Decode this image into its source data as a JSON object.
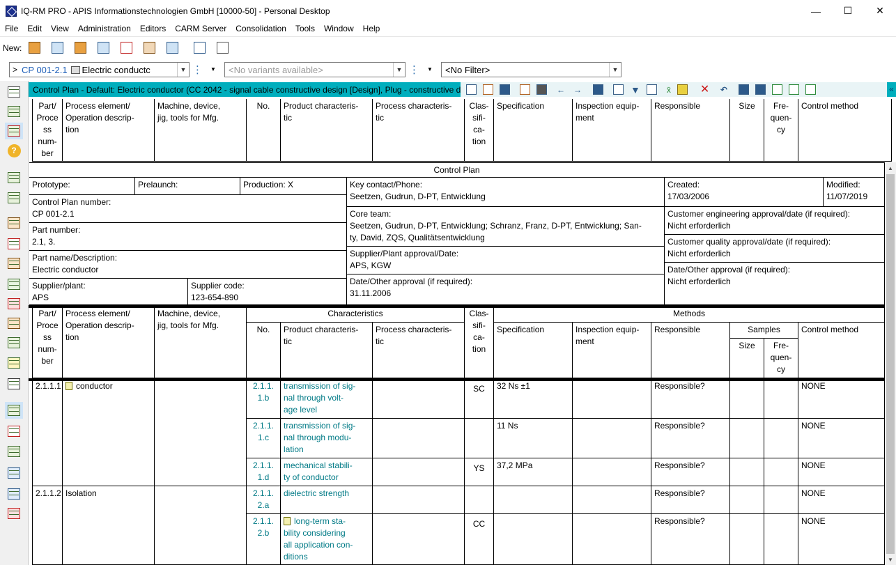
{
  "window": {
    "title": "IQ-RM PRO - APIS Informationstechnologien GmbH [10000-50] - Personal Desktop",
    "minimize": "—",
    "maximize": "☐",
    "close": "✕"
  },
  "menu": [
    "File",
    "Edit",
    "View",
    "Administration",
    "Editors",
    "CARM Server",
    "Consolidation",
    "Tools",
    "Window",
    "Help"
  ],
  "toolbar": {
    "new_label": "New:"
  },
  "selectors": {
    "doc_prefix": ">",
    "doc_id": "CP 001-2.1",
    "doc_name": "Electric conductc",
    "variants": "<No variants available>",
    "filter": "<No Filter>"
  },
  "panel": {
    "title": "Control Plan - Default: Electric conductor (CC 2042 - signal cable constructive design [Design], Plug - constructive d",
    "collapse": "«"
  },
  "columns": {
    "part": "Part/\nProce\nss\nnum-\nber",
    "process": "Process element/\nOperation descrip-\ntion",
    "machine": "Machine, device,\njig, tools for Mfg.",
    "no": "No.",
    "product": "Product characteris-\ntic",
    "proc_char": "Process characteris-\ntic",
    "classification": "Clas-\nsifi-\nca-\ntion",
    "specification": "Specification",
    "inspection": "Inspection equip-\nment",
    "responsible": "Responsible",
    "size": "Size",
    "frequency": "Fre-\nquen-\ncy",
    "control": "Control method",
    "characteristics": "Characteristics",
    "methods": "Methods",
    "samples": "Samples"
  },
  "header_block": {
    "title": "Control Plan",
    "prototype": "Prototype:",
    "prelaunch": "Prelaunch:",
    "production": "Production: X",
    "key_contact_label": "Key contact/Phone:",
    "key_contact": "Seetzen, Gudrun, D-PT, Entwicklung",
    "created_label": "Created:",
    "created": "17/03/2006",
    "modified_label": "Modified:",
    "modified": "11/07/2019",
    "cp_number_label": "Control Plan number:",
    "cp_number": "CP 001-2.1",
    "core_team_label": "Core team:",
    "core_team": "Seetzen, Gudrun, D-PT, Entwicklung; Schranz, Franz, D-PT, Entwicklung; San-\nty, David, ZQS, Qualitätsentwicklung",
    "cust_eng_label": "Customer engineering approval/date (if required):",
    "cust_eng": "Nicht erforderlich",
    "part_number_label": "Part number:",
    "part_number": "2.1, 3.",
    "cust_qual_label": "Customer quality approval/date (if required):",
    "cust_qual": "Nicht erforderlich",
    "part_name_label": "Part name/Description:",
    "part_name": "Electric conductor",
    "supplier_appr_label": "Supplier/Plant approval/Date:",
    "supplier_appr": "APS, KGW",
    "other_appr_label": "Date/Other approval (if required):",
    "other_appr": "Nicht erforderlich",
    "supplier_plant_label": "Supplier/plant:",
    "supplier_plant": "APS",
    "supplier_code_label": "Supplier code:",
    "supplier_code": "123-654-890",
    "date_other_label": "Date/Other approval (if required):",
    "date_other": "31.11.2006"
  },
  "rows": [
    {
      "no": "2.1.1.\n1.b",
      "product": "transmission of sig-\nnal through volt-\nage level",
      "class": "SC",
      "spec": "32 Ns ±1",
      "resp": "Responsible?",
      "control": "NONE"
    },
    {
      "no": "2.1.1.\n1.c",
      "product": "transmission of sig-\nnal through modu-\nlation",
      "class": "",
      "spec": "11 Ns",
      "resp": "Responsible?",
      "control": "NONE"
    },
    {
      "no": "2.1.1.\n1.d",
      "product": "mechanical stabili-\nty of conductor",
      "class": "YS",
      "spec": "37,2 MPa",
      "resp": "Responsible?",
      "control": "NONE"
    },
    {
      "no": "2.1.1.\n2.a",
      "product": "dielectric strength",
      "class": "",
      "spec": "",
      "resp": "Responsible?",
      "control": "NONE"
    },
    {
      "no": "2.1.1.\n2.b",
      "product": "long-term sta-\nbility considering\nall application con-\nditions",
      "class": "CC",
      "spec": "",
      "resp": "Responsible?",
      "control": "NONE"
    }
  ],
  "groups": [
    {
      "part": "2.1.1.1",
      "process": "conductor"
    },
    {
      "part": "2.1.1.2",
      "process": "Isolation"
    }
  ]
}
